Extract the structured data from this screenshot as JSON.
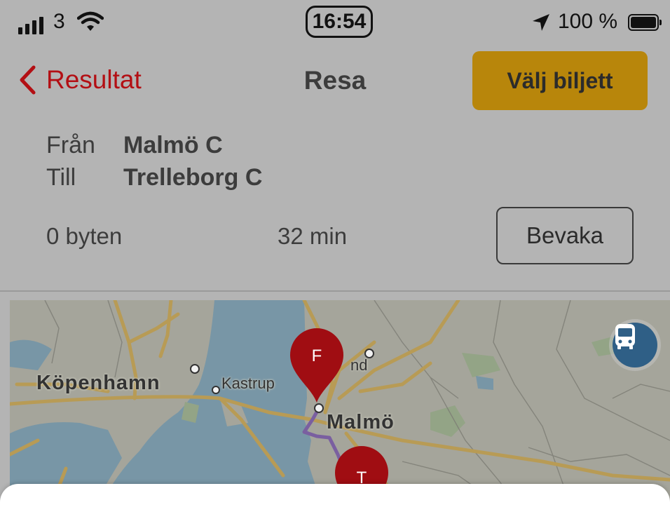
{
  "status_bar": {
    "carrier": "3",
    "time": "16:54",
    "battery": "100 %",
    "icons": [
      "signal-icon",
      "wifi-icon",
      "location-arrow-icon",
      "battery-icon"
    ]
  },
  "nav": {
    "back_label": "Resultat",
    "title": "Resa",
    "ticket_button": "Välj biljett"
  },
  "trip": {
    "from_label": "Från",
    "from_value": "Malmö C",
    "to_label": "Till",
    "to_value": "Trelleborg C",
    "changes": "0 byten",
    "duration": "32 min",
    "watch_button": "Bevaka"
  },
  "map": {
    "labels": {
      "copenhagen": "Köpenhamn",
      "kastrup": "Kastrup",
      "lund_fragment": "nd",
      "malmo": "Malmö"
    },
    "pins": {
      "from": "F",
      "to": "T"
    },
    "transit_icon": "bus-icon"
  },
  "colors": {
    "accent_red": "#b30f14",
    "ticket_button": "#b8860b",
    "pin_red": "#a00d12",
    "route": "#7a5fa0",
    "transit_button": "#2f5f86"
  }
}
